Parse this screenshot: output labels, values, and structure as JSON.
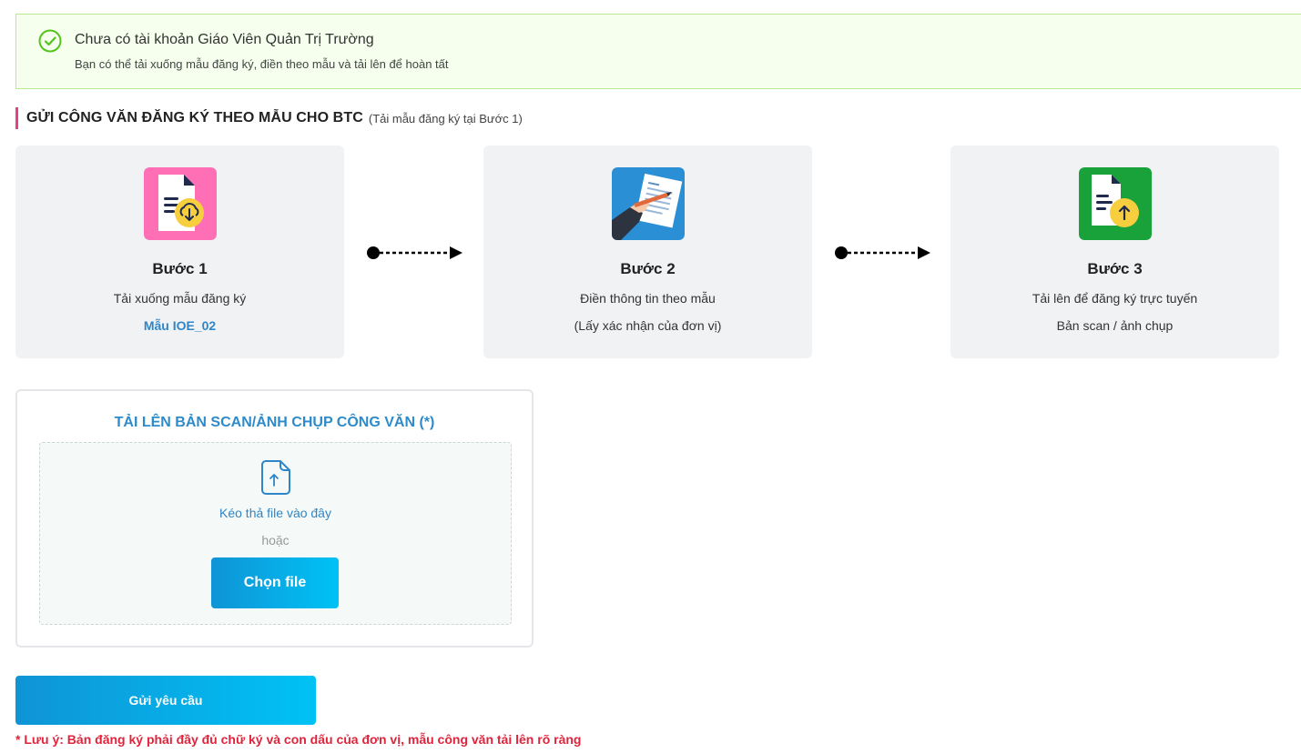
{
  "alert": {
    "title": "Chưa có tài khoản Giáo Viên Quản Trị Trường",
    "description": "Bạn có thể tải xuống mẫu đăng ký, điền theo mẫu và tải lên để hoàn tất",
    "icon": "check-circle-icon",
    "color": "#52c41a"
  },
  "section": {
    "heading": "GỬI CÔNG VĂN ĐĂNG KÝ THEO MẪU CHO BTC",
    "subheading": "(Tải mẫu đăng ký tại Bước 1)",
    "accent": "#e83e8c"
  },
  "steps": [
    {
      "name": "Bước 1",
      "line1": "Tải xuống mẫu đăng ký",
      "line2": "Mẫu IOE_02",
      "icon": "download-document-icon",
      "color": "#ff6fb5"
    },
    {
      "name": "Bước 2",
      "line1": "Điền thông tin theo mẫu",
      "line2": "(Lấy xác nhận của đơn vị)",
      "icon": "fill-form-icon",
      "color": "#2b8fd6"
    },
    {
      "name": "Bước 3",
      "line1": "Tải lên để đăng ký trực tuyến",
      "line2": "Bản scan / ảnh chụp",
      "icon": "upload-document-icon",
      "color": "#1aa23a"
    }
  ],
  "upload": {
    "title": "TẢI LÊN BẢN SCAN/ẢNH CHỤP CÔNG VĂN (*)",
    "drag_text": "Kéo thả file vào đây",
    "or_text": "hoặc",
    "choose_label": "Chọn file",
    "icon": "file-upload-icon"
  },
  "submit_label": "Gửi yêu cầu",
  "note": "* Lưu ý: Bản đăng ký phải đầy đủ chữ ký và con dấu của đơn vị, mẫu công văn tải lên rõ ràng"
}
